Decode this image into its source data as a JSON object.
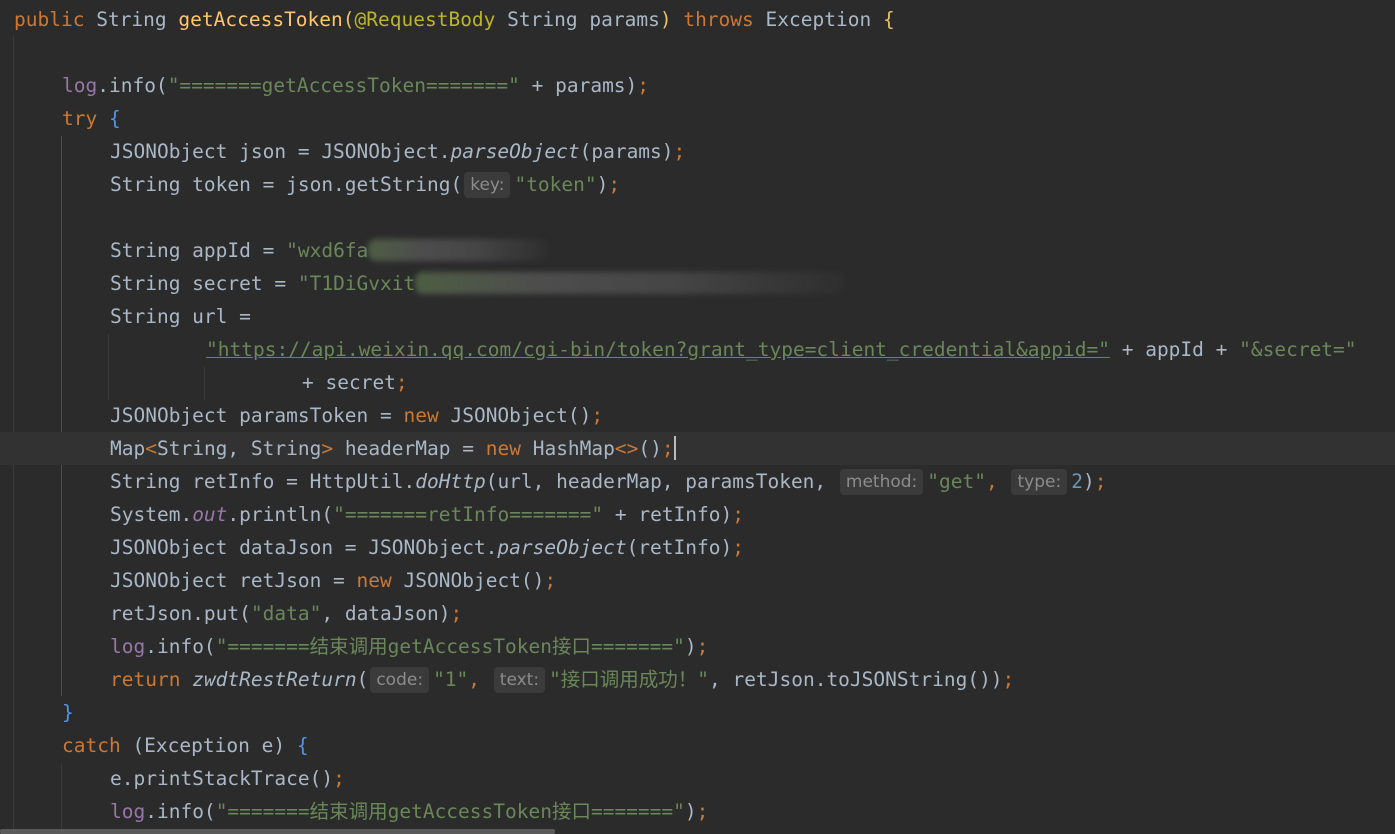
{
  "code": {
    "l01": {
      "public": "public",
      "string_type": "String",
      "method_name": "getAccessToken",
      "open_paren": "(",
      "annotation": "@RequestBody",
      "param_type": "String",
      "param_name": "params",
      "close_paren": ")",
      "throws": "throws",
      "exception": "Exception",
      "brace": "{"
    },
    "l03": {
      "log": "log",
      "call": ".info(",
      "str": "\"=======getAccessToken=======\"",
      "rest": " + params)",
      "semi": ";"
    },
    "l04": {
      "try": "try",
      "brace": "{"
    },
    "l05": {
      "pre": "JSONObject json = JSONObject.",
      "method": "parseObject",
      "rest": "(params)",
      "semi": ";"
    },
    "l06": {
      "pre": "String token = json.getString(",
      "hint": "key:",
      "str": "\"token\"",
      "close": ")",
      "semi": ";"
    },
    "l08": {
      "pre": "String appId = ",
      "str": "\"wxd6fa"
    },
    "l09": {
      "pre": "String secret = ",
      "str": "\"T1DiGvxit"
    },
    "l10": {
      "pre": "String url ="
    },
    "l11": {
      "str_url": "\"https://api.weixin.qq.com/cgi-bin/token?grant_type=client_credential&appid=\"",
      "mid": " + appId + ",
      "str_secret": "\"&secret=\""
    },
    "l12": {
      "pre": "+ secret",
      "semi": ";"
    },
    "l13": {
      "pre": "JSONObject paramsToken = ",
      "new": "new",
      "rest": " JSONObject()",
      "semi": ";"
    },
    "l14": {
      "map": "Map",
      "lt": "<",
      "types": "String, String",
      "gt": ">",
      "mid": " headerMap = ",
      "new": "new",
      "hashmap": " HashMap",
      "diamond": "<>",
      "parens": "()",
      "semi": ";"
    },
    "l15": {
      "pre": "String retInfo = HttpUtil.",
      "method": "doHttp",
      "args": "(url, headerMap, paramsToken, ",
      "hint_method": "method:",
      "str_get": "\"get\"",
      "comma": ", ",
      "hint_type": "type:",
      "num": "2",
      "close": ")",
      "semi": ";"
    },
    "l16": {
      "pre": "System.",
      "field": "out",
      "call": ".println(",
      "str": "\"=======retInfo=======\"",
      "rest": " + retInfo)",
      "semi": ";"
    },
    "l17": {
      "pre": "JSONObject dataJson = JSONObject.",
      "method": "parseObject",
      "rest": "(retInfo)",
      "semi": ";"
    },
    "l18": {
      "pre": "JSONObject retJson = ",
      "new": "new",
      "rest": " JSONObject()",
      "semi": ";"
    },
    "l19": {
      "pre": "retJson.put(",
      "str": "\"data\"",
      "rest": ", dataJson)",
      "semi": ";"
    },
    "l20": {
      "log": "log",
      "call": ".info(",
      "str": "\"=======结束调用getAccessToken接口=======\"",
      "close": ")",
      "semi": ";"
    },
    "l21": {
      "return": "return",
      "method": "zwdtRestReturn",
      "open": "(",
      "hint_code": "code:",
      "str_one": "\"1\"",
      "comma": ", ",
      "hint_text": "text:",
      "str_msg": "\"接口调用成功！\"",
      "rest": ", retJson.toJSONString())",
      "semi": ";"
    },
    "l22": {
      "brace": "}"
    },
    "l23": {
      "catch": "catch",
      "rest": " (Exception e) ",
      "brace": "{"
    },
    "l24": {
      "pre": "e.printStackTrace()",
      "semi": ";"
    },
    "l25": {
      "log": "log",
      "call": ".info(",
      "str": "\"=======结束调用getAccessToken接口=======\"",
      "close": ")",
      "semi": ";"
    }
  }
}
